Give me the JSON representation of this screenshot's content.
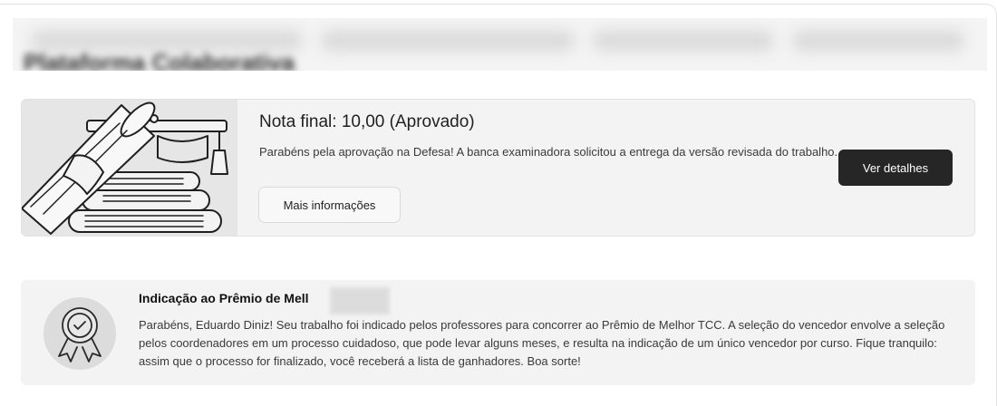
{
  "header": {
    "title": "Plataforma Colaborativa"
  },
  "grade_card": {
    "title": "Nota final: 10,00 (Aprovado)",
    "message": "Parabéns pela aprovação na Defesa! A banca examinadora solicitou a entrega da versão revisada do trabalho.",
    "more_info_label": "Mais informações",
    "details_label": "Ver detalhes",
    "illustration_icon": "graduation-diploma-books-icon"
  },
  "award_card": {
    "title": "Indicação ao Prêmio de Mell",
    "message": "Parabéns, Eduardo Diniz! Seu trabalho foi indicado pelos professores para concorrer ao Prêmio de Melhor TCC. A seleção do vencedor envolve a seleção pelos coordenadores em um processo cuidadoso, que pode levar alguns meses, e resulta na indicação de um único vencedor por curso. Fique tranquilo: assim que o processo for finalizado, você receberá a lista de ganhadores. Boa sorte!",
    "badge_icon": "award-badge-icon"
  },
  "colors": {
    "card_bg": "#f3f3f3",
    "primary_button": "#262626",
    "illustration_bg": "#e6e6e6"
  }
}
